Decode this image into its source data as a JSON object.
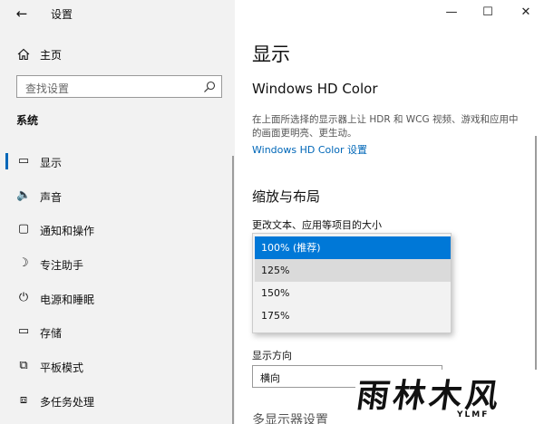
{
  "window": {
    "title": "设置",
    "controls": {
      "minimize": "—",
      "maximize": "☐",
      "close": "✕"
    }
  },
  "sidebar": {
    "home_label": "主页",
    "search_placeholder": "查找设置",
    "section_title": "系统",
    "items": [
      {
        "label": "显示",
        "icon": "monitor-icon",
        "glyph": "▭",
        "active": true
      },
      {
        "label": "声音",
        "icon": "speaker-icon",
        "glyph": "🔈",
        "active": false
      },
      {
        "label": "通知和操作",
        "icon": "notification-icon",
        "glyph": "▢",
        "active": false
      },
      {
        "label": "专注助手",
        "icon": "moon-icon",
        "glyph": "☽",
        "active": false
      },
      {
        "label": "电源和睡眠",
        "icon": "power-icon",
        "glyph": "⏻",
        "active": false
      },
      {
        "label": "存储",
        "icon": "storage-icon",
        "glyph": "▭",
        "active": false
      },
      {
        "label": "平板模式",
        "icon": "tablet-icon",
        "glyph": "⧉",
        "active": false
      },
      {
        "label": "多任务处理",
        "icon": "multitask-icon",
        "glyph": "⧈",
        "active": false
      }
    ]
  },
  "main": {
    "page_title": "显示",
    "hdr": {
      "title": "Windows HD Color",
      "description": "在上面所选择的显示器上让 HDR 和 WCG 视频、游戏和应用中的画面更明亮、更生动。",
      "link": "Windows HD Color 设置"
    },
    "scale": {
      "title": "缩放与布局",
      "label": "更改文本、应用等项目的大小",
      "options": [
        "100% (推荐)",
        "125%",
        "150%",
        "175%"
      ],
      "selected_index": 0
    },
    "orientation": {
      "label": "显示方向",
      "value": "横向"
    },
    "next_section": "多显示器设置"
  },
  "watermark": {
    "main": "雨林木风",
    "sub": "YLMF"
  },
  "colors": {
    "accent": "#0067b8",
    "selected": "#0078d7",
    "sidebar_bg": "#f2f2f2"
  }
}
